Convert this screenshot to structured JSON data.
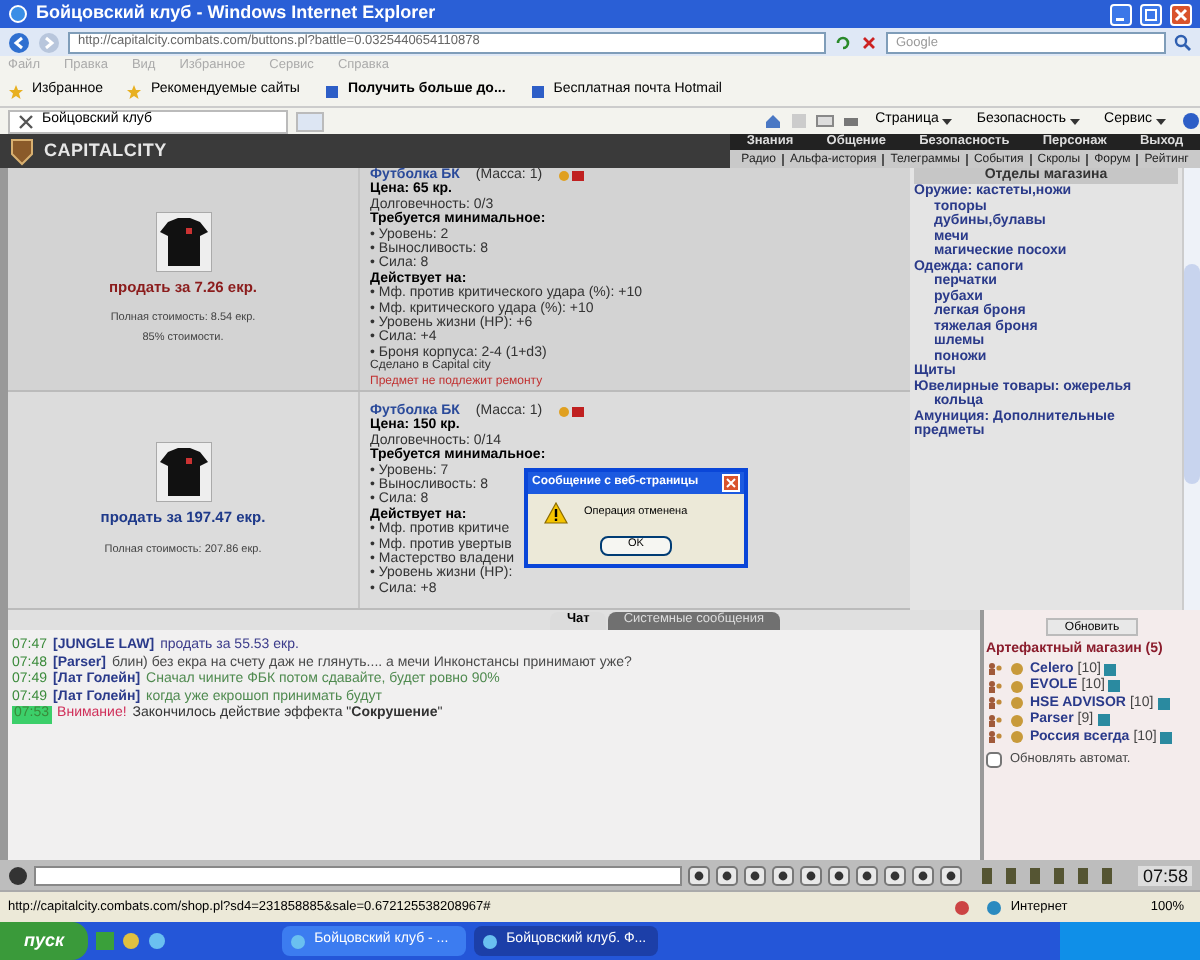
{
  "window": {
    "title": "Бойцовский клуб - Windows Internet Explorer"
  },
  "address_bar": {
    "url": "http://capitalcity.combats.com/buttons.pl?battle=0.0325440654110878",
    "search_placeholder": "Google"
  },
  "menu": [
    "Файл",
    "Правка",
    "Вид",
    "Избранное",
    "Сервис",
    "Справка"
  ],
  "favorites": [
    "Избранное",
    "Рекомендуемые сайты",
    "Получить больше до...",
    "Бесплатная почта Hotmail"
  ],
  "tab": {
    "label": "Бойцовский клуб"
  },
  "command_bar": [
    "Страница",
    "Безопасность",
    "Сервис"
  ],
  "game": {
    "logo": "CAPITALCITY",
    "nav_main": [
      "Знания",
      "Общение",
      "Безопасность",
      "Персонаж",
      "Выход"
    ],
    "nav_sub": [
      "Радио",
      "Альфа-история",
      "Телеграммы",
      "События",
      "Скролы",
      "Форум",
      "Рейтинг"
    ]
  },
  "items": [
    {
      "name": "Футболка БК",
      "mass": "(Масса: 1)",
      "price": "Цена: 65 кр.",
      "durability": "Долговечность: 0/3",
      "req_title": "Требуется минимальное:",
      "requirements": [
        "• Уровень: 2",
        "• Выносливость: 8",
        "• Сила: 8"
      ],
      "effects_title": "Действует на:",
      "effects": [
        "• Мф. против критического удара (%): +10",
        "• Мф. критического удара (%): +10",
        "• Уровень жизни (HP): +6",
        "• Сила: +4",
        "• Броня корпуса: 2-4 (1+d3)"
      ],
      "made": "Сделано в Capital city",
      "note": "Предмет не подлежит ремонту",
      "sell": "продать за 7.26 екр.",
      "color": "#8b1c1c",
      "full_cost": "Полная стоимость: 8.54 екр.",
      "percent": "85% стоимости."
    },
    {
      "name": "Футболка БК",
      "mass": "(Масса: 1)",
      "price": "Цена: 150 кр.",
      "durability": "Долговечность: 0/14",
      "req_title": "Требуется минимальное:",
      "requirements": [
        "• Уровень: 7",
        "• Выносливость: 8",
        "• Сила: 8"
      ],
      "effects_title": "Действует на:",
      "effects": [
        "• Мф. против критиче",
        "• Мф. против увертыв",
        "• Мастерство владени",
        "• Уровень жизни (HP):",
        "• Сила: +8"
      ],
      "sell": "продать за 197.47 екр.",
      "color": "#1f3a8a",
      "full_cost": "Полная стоимость: 207.86 екр."
    }
  ],
  "shop_sections": {
    "title": "Отделы магазина",
    "groups": [
      {
        "label": "Оружие: кастеты,ножи",
        "children": [
          "топоры",
          "дубины,булавы",
          "мечи",
          "магические посохи"
        ]
      },
      {
        "label": "Одежда: сапоги",
        "children": [
          "перчатки",
          "рубахи",
          "легкая броня",
          "тяжелая броня",
          "шлемы",
          "поножи"
        ]
      },
      {
        "label": "Щиты"
      },
      {
        "label": "Ювелирные товары: ожерелья",
        "children": [
          "кольца"
        ]
      },
      {
        "label": "Амуниция: Дополнительные предметы"
      }
    ]
  },
  "dialog": {
    "title": "Сообщение с веб-страницы",
    "message": "Операция отменена",
    "button": "OK"
  },
  "chat_tabs": [
    {
      "label": "Чат",
      "selected": true
    },
    {
      "label": "Системные сообщения",
      "selected": false
    }
  ],
  "chat": [
    {
      "kind": "user",
      "time": "07:47",
      "nick": "[JUNGLE LAW]",
      "text": "продать за 55.53 екр.",
      "color": "#3b3b8a"
    },
    {
      "kind": "user",
      "time": "07:48",
      "nick": "[Parser]",
      "text": "блин) без екра на счету даж не глянуть.... а мечи Инконстансы принимают уже?",
      "color": "#4a4a4a"
    },
    {
      "kind": "user",
      "time": "07:49",
      "nick": "[Лат Голейн]",
      "text": "Сначал чините ФБК потом сдавайте, будет ровно 90%",
      "color": "#4f8a4f"
    },
    {
      "kind": "user",
      "time": "07:49",
      "nick": "[Лат Голейн]",
      "text": "когда уже екрошоп принимать будут",
      "color": "#4f8a4f"
    },
    {
      "kind": "system",
      "time": "07:53",
      "label": "Внимание!",
      "text": "Закончилось действие эффекта \"**Сокрушение**\""
    }
  ],
  "room": {
    "refresh": "Обновить",
    "title": "Артефактный магазин (5)",
    "users": [
      {
        "name": "Celero",
        "level": "[10]"
      },
      {
        "name": "EVOLE",
        "level": "[10]"
      },
      {
        "name": "HSE ADVISOR",
        "level": "[10]"
      },
      {
        "name": "Parser",
        "level": "[9]"
      },
      {
        "name": "Россия всегда",
        "level": "[10]"
      }
    ],
    "auto_refresh": {
      "label": "Обновлять автомат.",
      "checked": false
    }
  },
  "clock": "07:58",
  "status_bar": {
    "url": "http://capitalcity.combats.com/shop.pl?sd4=231858885&sale=0.672125538208967#",
    "zone": "Интернет",
    "zoom": "100%"
  },
  "taskbar": {
    "start": "пуск",
    "tasks": [
      {
        "label": "Бойцовский клуб - ...",
        "selected": false
      },
      {
        "label": "Бойцовский клуб. Ф...",
        "selected": true
      }
    ]
  }
}
